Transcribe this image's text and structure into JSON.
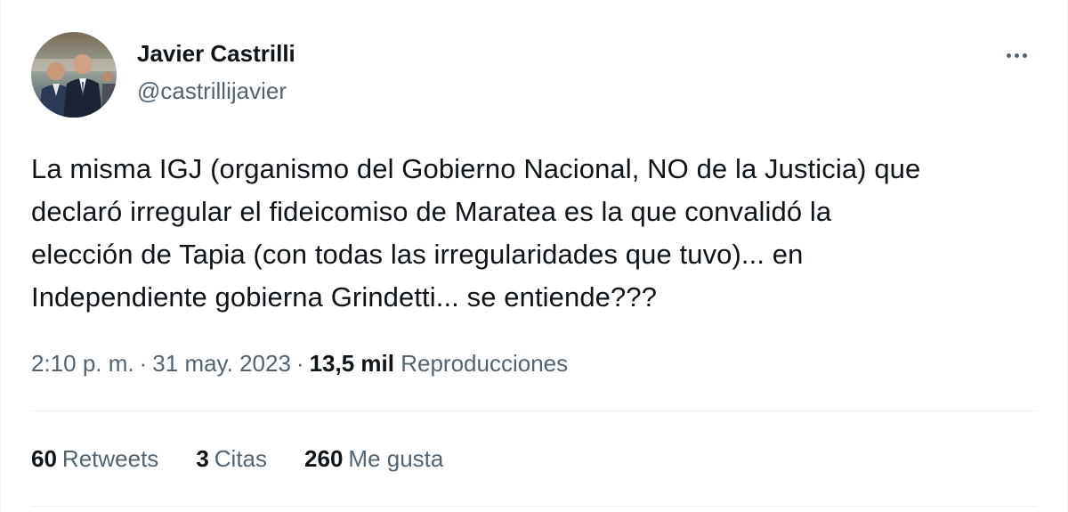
{
  "tweet": {
    "author": {
      "name": "Javier Castrilli",
      "handle": "@castrillijavier"
    },
    "text_lines": [
      "La misma IGJ (organismo del Gobierno Nacional, NO de la Justicia) que",
      "declaró irregular el fideicomiso de Maratea es la que convalidó la",
      "elección de Tapia (con todas las irregularidades que tuvo)... en",
      "Independiente gobierna Grindetti... se entiende???"
    ],
    "meta": {
      "time": "2:10 p. m.",
      "separator": "·",
      "date": "31 may. 2023",
      "views_count": "13,5 mil",
      "views_label": "Reproducciones"
    },
    "stats": {
      "retweets": {
        "count": "60",
        "label": "Retweets"
      },
      "quotes": {
        "count": "3",
        "label": "Citas"
      },
      "likes": {
        "count": "260",
        "label": "Me gusta"
      }
    },
    "more_icon": "more-horizontal-icon"
  },
  "colors": {
    "text_primary": "#0f1419",
    "text_secondary": "#536471",
    "divider": "#eff3f4",
    "background": "#ffffff"
  }
}
